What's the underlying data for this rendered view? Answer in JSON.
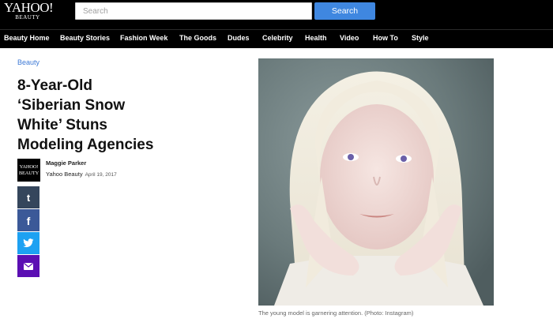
{
  "header": {
    "logo_main": "YAHOO!",
    "logo_sub": "BEAUTY",
    "search_placeholder": "Search",
    "search_button": "Search"
  },
  "nav": {
    "items": [
      "Beauty Home",
      "Beauty Stories",
      "Fashion Week",
      "The Goods",
      "Dudes",
      "Celebrity",
      "Health",
      "Video",
      "How To",
      "Style"
    ]
  },
  "article": {
    "category": "Beauty",
    "headline_lines": [
      "8-Year-Old",
      "‘Siberian Snow",
      "White’ Stuns",
      "Modeling Agencies"
    ],
    "author": {
      "avatar_text": "YAHOO! BEAUTY",
      "name": "Maggie Parker",
      "source": "Yahoo Beauty",
      "date": "April 19, 2017"
    },
    "share": [
      {
        "name": "tumblr",
        "icon": "tumblr-icon",
        "glyph": "t",
        "color": "#35465c"
      },
      {
        "name": "facebook",
        "icon": "facebook-icon",
        "glyph": "f",
        "color": "#3b5998"
      },
      {
        "name": "twitter",
        "icon": "twitter-icon",
        "glyph": "",
        "color": "#1da1f2"
      },
      {
        "name": "email",
        "icon": "mail-icon",
        "glyph": "",
        "color": "#5b0fb3"
      }
    ],
    "caption": "The young model is garnering attention. (Photo: Instagram)"
  },
  "colors": {
    "topbar": "#000000",
    "search_button": "#3f87e0",
    "category_link": "#3e7ad6"
  }
}
